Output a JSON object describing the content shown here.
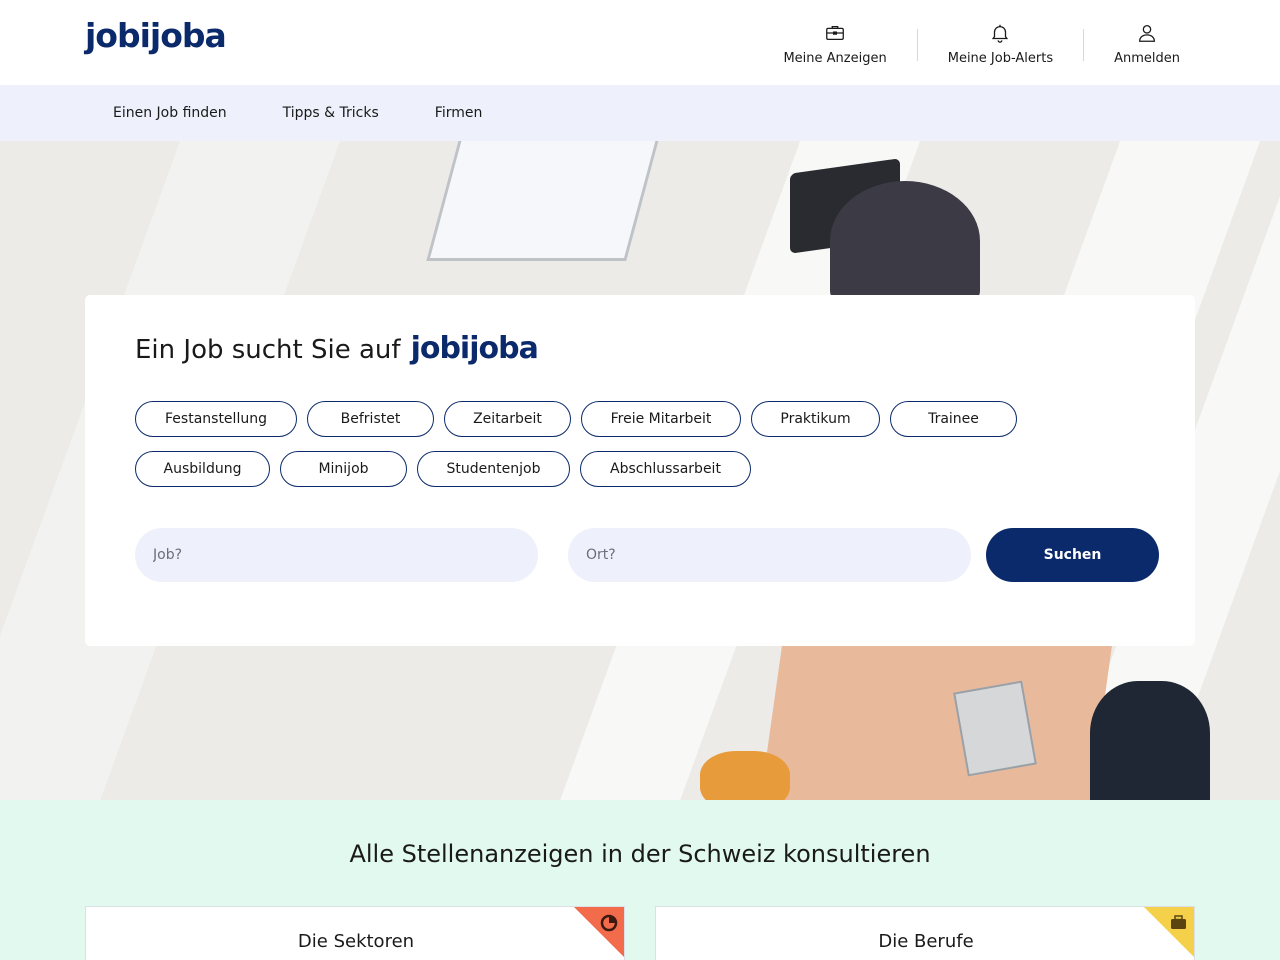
{
  "brand": {
    "name": "jobijoba",
    "color": "#0b2a6b"
  },
  "header": {
    "items": [
      {
        "label": "Meine Anzeigen",
        "icon": "briefcase-icon"
      },
      {
        "label": "Meine Job-Alerts",
        "icon": "bell-icon"
      },
      {
        "label": "Anmelden",
        "icon": "user-icon"
      }
    ]
  },
  "subnav": {
    "items": [
      {
        "label": "Einen Job finden"
      },
      {
        "label": "Tipps & Tricks"
      },
      {
        "label": "Firmen"
      }
    ]
  },
  "search_card": {
    "title": "Ein Job sucht Sie auf",
    "title_logo": "jobijoba",
    "chips_row1": [
      "Festanstellung",
      "Befristet",
      "Zeitarbeit",
      "Freie Mitarbeit",
      "Praktikum",
      "Trainee"
    ],
    "chips_row2": [
      "Ausbildung",
      "Minijob",
      "Studentenjob",
      "Abschlussarbeit"
    ],
    "job_placeholder": "Job?",
    "location_placeholder": "Ort?",
    "search_label": "Suchen"
  },
  "listing": {
    "title": "Alle Stellenanzeigen in der Schweiz konsultieren",
    "tiles": [
      {
        "title": "Die Sektoren",
        "icon": "pie-chart-icon",
        "corner_color": "#f26b4a"
      },
      {
        "title": "Die Berufe",
        "icon": "briefcase-icon",
        "corner_color": "#f5d04a"
      }
    ]
  }
}
